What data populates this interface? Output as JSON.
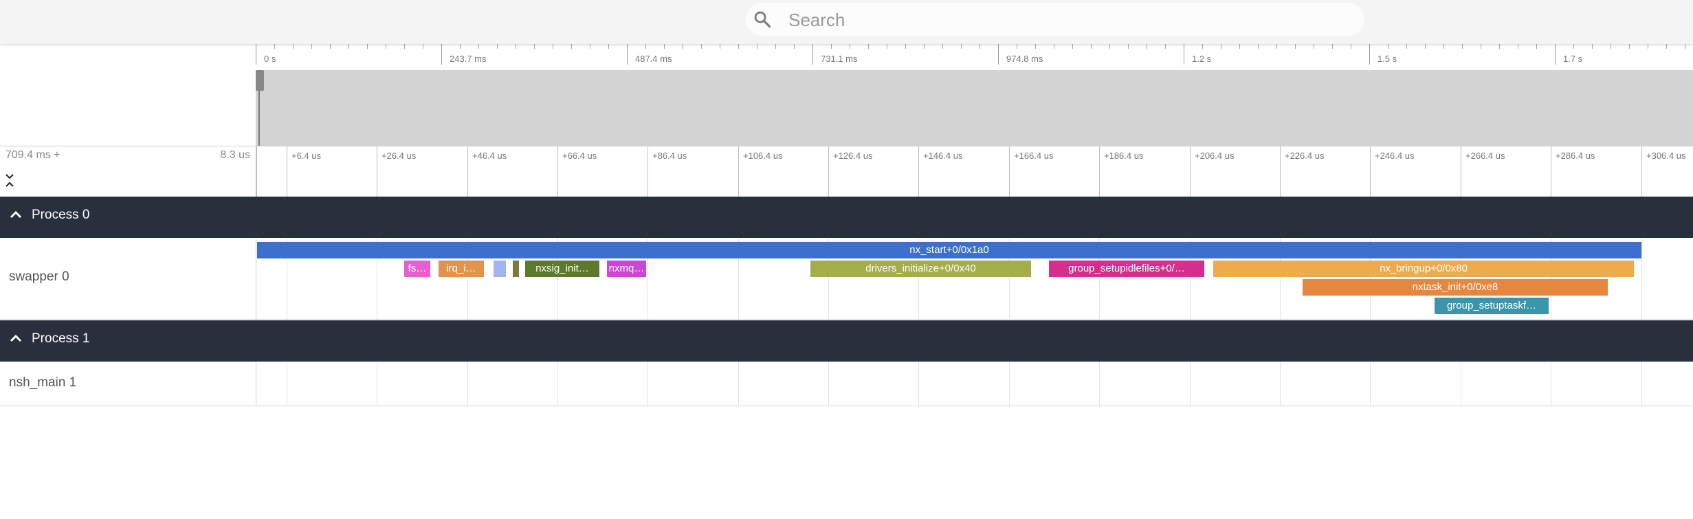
{
  "search": {
    "placeholder": "Search"
  },
  "overview": {
    "labels": [
      "0 s",
      "243.7 ms",
      "487.4 ms",
      "731.1 ms",
      "974.8 ms",
      "1.2 s",
      "1.5 s",
      "1.7 s"
    ]
  },
  "detail": {
    "offset": "709.4 ms +",
    "scale": "8.3 us",
    "labels": [
      "+6.4 us",
      "+26.4 us",
      "+46.4 us",
      "+66.4 us",
      "+86.4 us",
      "+106.4 us",
      "+126.4 us",
      "+146.4 us",
      "+166.4 us",
      "+186.4 us",
      "+206.4 us",
      "+226.4 us",
      "+246.4 us",
      "+266.4 us",
      "+286.4 us",
      "+306.4 us"
    ]
  },
  "processes": [
    {
      "title": "Process 0",
      "track": "swapper 0",
      "slices": [
        {
          "label": "nx_start+0/0x1a0",
          "color": "#3d6fcf"
        },
        {
          "label": "fs…",
          "color": "#e661d0"
        },
        {
          "label": "irq_i…",
          "color": "#e0954a"
        },
        {
          "label": "",
          "color": "#a5b3ee"
        },
        {
          "label": "",
          "color": "#7a7a3a"
        },
        {
          "label": "nxsig_init…",
          "color": "#5d7a2c"
        },
        {
          "label": "nxmq…",
          "color": "#c948d6"
        },
        {
          "label": "drivers_initialize+0/0x40",
          "color": "#a3ad4a"
        },
        {
          "label": "group_setupidlefiles+0/…",
          "color": "#d62e8c"
        },
        {
          "label": "nx_bringup+0/0x80",
          "color": "#eeab4e"
        },
        {
          "label": "nxtask_init+0/0xe8",
          "color": "#e5873e"
        },
        {
          "label": "group_setuptaskf…",
          "color": "#3b96ab"
        }
      ]
    },
    {
      "title": "Process 1",
      "track": "nsh_main 1",
      "slices": []
    }
  ],
  "colors": {
    "process_header_bg": "#29303d",
    "overview_track": "#d3d3d3"
  }
}
